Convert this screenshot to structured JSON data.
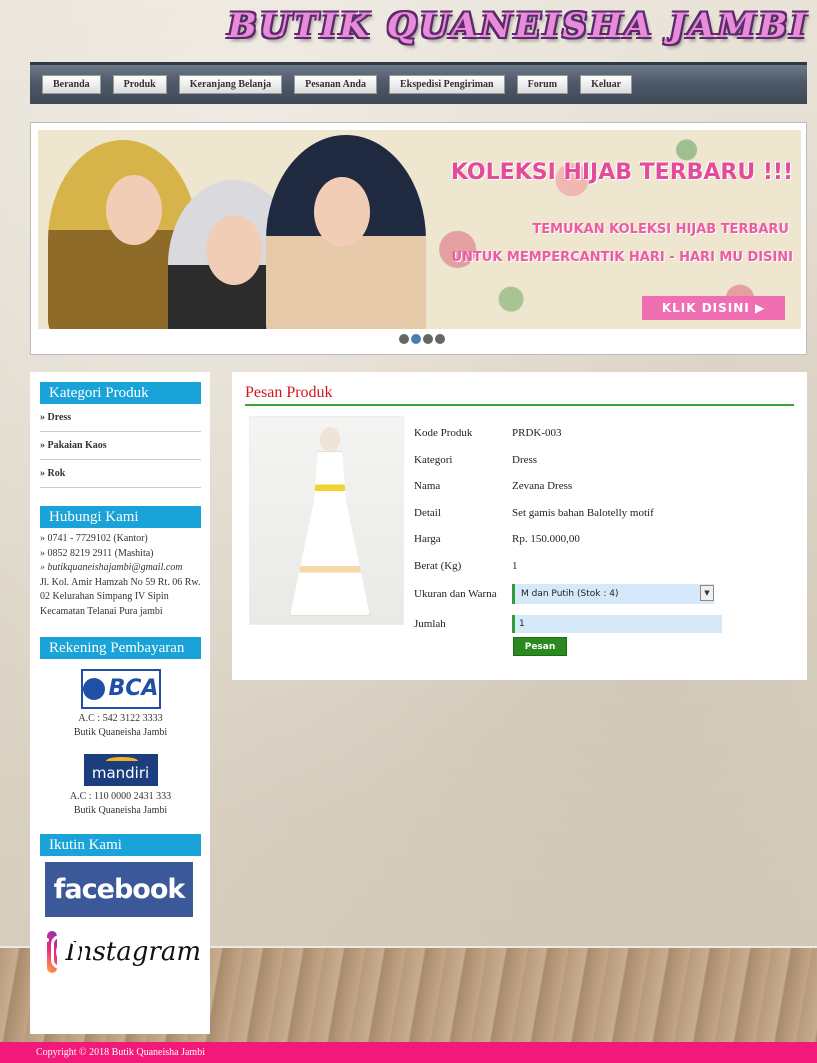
{
  "site": {
    "title": "BUTIK QUANEISHA JAMBI"
  },
  "nav": {
    "items": [
      "Beranda",
      "Produk",
      "Keranjang Belanja",
      "Pesanan Anda",
      "Ekspedisi Pengiriman",
      "Forum",
      "Keluar"
    ]
  },
  "banner": {
    "headline": "KOLEKSI HIJAB TERBARU !!!",
    "line1": "TEMUKAN KOLEKSI HIJAB TERBARU",
    "line2": "UNTUK MEMPERCANTIK HARI - HARI MU DISINI",
    "cta": "KLIK DISINI",
    "slides": 4,
    "active_slide": 2
  },
  "sidebar": {
    "category_title": "Kategori Produk",
    "categories": [
      "» Dress",
      "» Pakaian Kaos",
      "» Rok"
    ],
    "contact_title": "Hubungi Kami",
    "contact": {
      "office": "» 0741 - 7729102 (Kantor)",
      "mobile": "» 0852 8219 2911 (Mashita)",
      "email": "» butikquaneishajambi@gmail.com",
      "address": "Jl. Kol. Amir Hamzah No 59 Rt. 06 Rw. 02 Kelurahan Simpang IV Sipin Kecamatan Telanai Pura jambi"
    },
    "payment_title": "Rekening Pembayaran",
    "banks": [
      {
        "logo": "BCA",
        "account": "A.C : 542 3122 3333",
        "holder": "Butik Quaneisha Jambi"
      },
      {
        "logo": "mandiri",
        "account": "A.C : 110 0000 2431 333",
        "holder": "Butik Quaneisha Jambi"
      }
    ],
    "follow_title": "Ikutin Kami",
    "social": {
      "facebook": "facebook",
      "instagram": "Instagram"
    }
  },
  "product": {
    "section_title": "Pesan Produk",
    "fields": [
      {
        "label": "Kode Produk",
        "value": "PRDK-003"
      },
      {
        "label": "Kategori",
        "value": "Dress"
      },
      {
        "label": "Nama",
        "value": "Zevana Dress"
      },
      {
        "label": "Detail",
        "value": "Set gamis bahan Balotelly motif"
      },
      {
        "label": "Harga",
        "value": "Rp. 150.000,00"
      },
      {
        "label": "Berat (Kg)",
        "value": "1"
      }
    ],
    "variant_label": "Ukuran dan Warna",
    "variant_selected": "M dan Putih (Stok : 4)",
    "qty_label": "Jumlah",
    "qty_value": "1",
    "order_button": "Pesan"
  },
  "footer": {
    "copyright": "Copyright © 2018 Butik Quaneisha Jambi"
  },
  "colors": {
    "nav": "#4e5a6a",
    "sidebar_head": "#1aa3d8",
    "title_red": "#d4141e",
    "accent_green": "#2b8a1f",
    "footer": "#f2197a"
  }
}
